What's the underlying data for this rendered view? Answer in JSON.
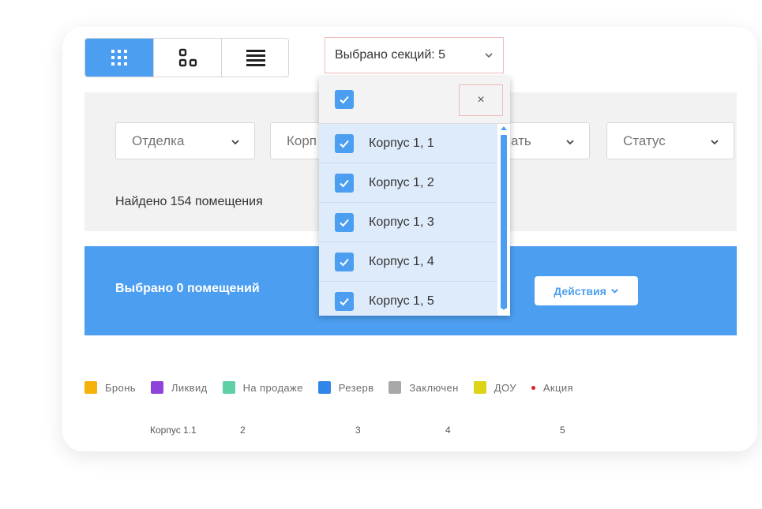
{
  "toolbar": {
    "views": [
      {
        "name": "view-grid-icon",
        "active": true
      },
      {
        "name": "view-tiles-icon",
        "active": false
      },
      {
        "name": "view-list-icon",
        "active": false
      }
    ],
    "sections_label": "Выбрано секций: 5"
  },
  "filters": [
    {
      "label": "Отделка"
    },
    {
      "label": "Корп"
    },
    {
      "label": "ать"
    },
    {
      "label": "Статус"
    }
  ],
  "found_text": "Найдено 154 помещения",
  "selection_bar": {
    "selected_text": "Выбрано 0 помещений",
    "actions_label": "Действия"
  },
  "legend": [
    {
      "label": "Бронь",
      "color": "#f6b10b"
    },
    {
      "label": "Ликвид",
      "color": "#8e44d8"
    },
    {
      "label": "На продаже",
      "color": "#5fcfa6"
    },
    {
      "label": "Резерв",
      "color": "#2f86e8"
    },
    {
      "label": "Заключен",
      "color": "#a8a8a8"
    },
    {
      "label": "ДОУ",
      "color": "#ddd317"
    },
    {
      "label": "Акция",
      "color": "#e02020",
      "dot": true
    }
  ],
  "axis_labels": [
    "Корпус 1.1",
    "2",
    "3",
    "4",
    "5"
  ],
  "dropdown": {
    "close_symbol": "×",
    "items": [
      {
        "label": "Корпус 1, 1",
        "checked": true
      },
      {
        "label": "Корпус 1, 2",
        "checked": true
      },
      {
        "label": "Корпус 1, 3",
        "checked": true
      },
      {
        "label": "Корпус 1, 4",
        "checked": true
      },
      {
        "label": "Корпус 1, 5",
        "checked": true
      }
    ]
  }
}
